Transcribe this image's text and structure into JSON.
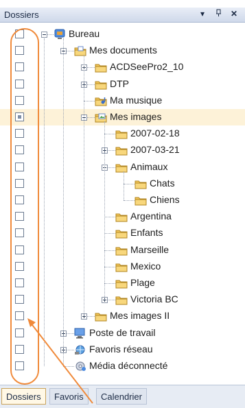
{
  "panel": {
    "title": "Dossiers",
    "buttons": {
      "dropdown": "▾",
      "pin": "ᵖ",
      "close": "✕"
    }
  },
  "tree": [
    {
      "label": "Bureau",
      "icon": "desktop-icon",
      "expander": "minus",
      "checkbox": "unchecked",
      "selected": false
    },
    {
      "label": "Mes documents",
      "icon": "documents-folder-icon",
      "expander": "minus",
      "checkbox": "unchecked",
      "selected": false
    },
    {
      "label": "ACDSeePro2_10",
      "icon": "folder-icon",
      "expander": "plus",
      "checkbox": "unchecked",
      "selected": false
    },
    {
      "label": "DTP",
      "icon": "folder-icon",
      "expander": "plus",
      "checkbox": "unchecked",
      "selected": false
    },
    {
      "label": "Ma musique",
      "icon": "music-folder-icon",
      "expander": "none",
      "checkbox": "unchecked",
      "selected": false
    },
    {
      "label": "Mes images",
      "icon": "pictures-folder-icon",
      "expander": "minus",
      "checkbox": "partial",
      "selected": true
    },
    {
      "label": "2007-02-18",
      "icon": "folder-icon",
      "expander": "none",
      "checkbox": "unchecked",
      "selected": false
    },
    {
      "label": "2007-03-21",
      "icon": "folder-icon",
      "expander": "plus",
      "checkbox": "unchecked",
      "selected": false
    },
    {
      "label": "Animaux",
      "icon": "folder-icon",
      "expander": "minus",
      "checkbox": "unchecked",
      "selected": false
    },
    {
      "label": "Chats",
      "icon": "folder-icon",
      "expander": "none",
      "checkbox": "unchecked",
      "selected": false
    },
    {
      "label": "Chiens",
      "icon": "folder-icon",
      "expander": "none",
      "checkbox": "unchecked",
      "selected": false
    },
    {
      "label": "Argentina",
      "icon": "folder-icon",
      "expander": "none",
      "checkbox": "unchecked",
      "selected": false
    },
    {
      "label": "Enfants",
      "icon": "folder-icon",
      "expander": "none",
      "checkbox": "unchecked",
      "selected": false
    },
    {
      "label": "Marseille",
      "icon": "folder-icon",
      "expander": "none",
      "checkbox": "unchecked",
      "selected": false
    },
    {
      "label": "Mexico",
      "icon": "folder-icon",
      "expander": "none",
      "checkbox": "unchecked",
      "selected": false
    },
    {
      "label": "Plage",
      "icon": "folder-icon",
      "expander": "none",
      "checkbox": "unchecked",
      "selected": false
    },
    {
      "label": "Victoria BC",
      "icon": "folder-icon",
      "expander": "plus",
      "checkbox": "unchecked",
      "selected": false
    },
    {
      "label": "Mes images II",
      "icon": "folder-icon",
      "expander": "plus",
      "checkbox": "unchecked",
      "selected": false
    },
    {
      "label": "Poste de travail",
      "icon": "computer-icon",
      "expander": "plus",
      "checkbox": "unchecked",
      "selected": false
    },
    {
      "label": "Favoris réseau",
      "icon": "network-icon",
      "expander": "plus",
      "checkbox": "unchecked",
      "selected": false
    },
    {
      "label": "Média déconnecté",
      "icon": "offline-media-icon",
      "expander": "none",
      "checkbox": "unchecked",
      "selected": false
    }
  ],
  "tabs": [
    {
      "label": "Dossiers",
      "active": true
    },
    {
      "label": "Favoris",
      "active": false
    },
    {
      "label": "Calendrier",
      "active": false
    }
  ],
  "colors": {
    "selection": "#fdf2d8",
    "annotation": "#f08a3a",
    "folder": "#f4c75a"
  }
}
